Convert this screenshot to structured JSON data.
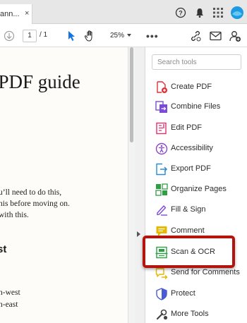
{
  "tabbar": {
    "tab_title": "ann...",
    "close_glyph": "×",
    "icons": [
      "help-icon",
      "bell-icon",
      "apps-grid-icon",
      "avatar"
    ]
  },
  "toolbar": {
    "current_page": "1",
    "page_separator": "/ 1",
    "zoom": "25%",
    "more": "•••",
    "icons": [
      "download-icon",
      "select-arrow-icon",
      "hand-pan-icon",
      "share-link-icon",
      "mail-icon",
      "add-user-icon"
    ]
  },
  "document": {
    "heading": "s for PDF guide",
    "body_lines": [
      "u’ll need to do this,",
      "his before moving on.",
      "with this."
    ],
    "subheading": "st",
    "list_lines": [
      "h-west",
      "h-east"
    ]
  },
  "tools_pane": {
    "search_placeholder": "Search tools",
    "items": [
      {
        "label": "Create PDF",
        "icon": "create-pdf-icon",
        "color": "#e0303a"
      },
      {
        "label": "Combine Files",
        "icon": "combine-files-icon",
        "color": "#7b4bd6"
      },
      {
        "label": "Edit PDF",
        "icon": "edit-pdf-icon",
        "color": "#e0306a"
      },
      {
        "label": "Accessibility",
        "icon": "accessibility-icon",
        "color": "#8a45c4"
      },
      {
        "label": "Export PDF",
        "icon": "export-pdf-icon",
        "color": "#2a8bd1"
      },
      {
        "label": "Organize Pages",
        "icon": "organize-pages-icon",
        "color": "#2f9e44"
      },
      {
        "label": "Fill & Sign",
        "icon": "fill-sign-icon",
        "color": "#7b4bd6"
      },
      {
        "label": "Comment",
        "icon": "comment-icon",
        "color": "#e6b800"
      },
      {
        "label": "Scan & OCR",
        "icon": "scan-ocr-icon",
        "color": "#2f9e44"
      },
      {
        "label": "Send for Comments",
        "icon": "send-comments-icon",
        "color": "#e6b800"
      },
      {
        "label": "Protect",
        "icon": "protect-icon",
        "color": "#4a5bd4"
      },
      {
        "label": "More Tools",
        "icon": "more-tools-icon",
        "color": "#444444"
      }
    ],
    "highlighted": "Scan & OCR",
    "highlight_color": "#b3140d"
  }
}
